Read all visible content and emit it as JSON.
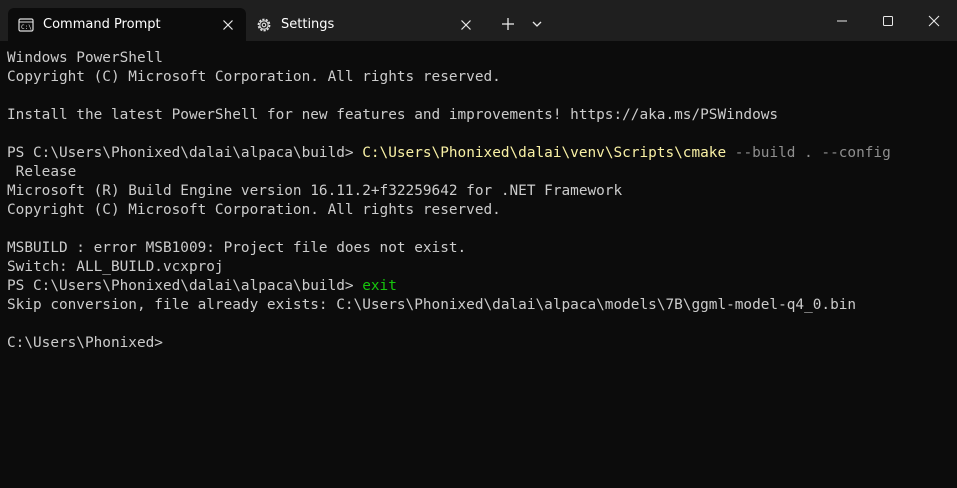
{
  "window": {
    "tabs": [
      {
        "label": "Command Prompt",
        "icon": "terminal-icon",
        "active": true
      },
      {
        "label": "Settings",
        "icon": "gear-icon",
        "active": false
      }
    ],
    "new_tab_icon": "plus-icon",
    "dropdown_icon": "chevron-down-icon",
    "controls": [
      "minimize-icon",
      "maximize-icon",
      "close-icon"
    ]
  },
  "colors": {
    "background": "#0c0c0c",
    "titlebar": "#1f1f1f",
    "text": "#cccccc",
    "command": "#f9f1a5",
    "argument": "#8f8f8f",
    "keyword": "#16c60c"
  },
  "terminal": {
    "lines": [
      [
        {
          "text": "Windows PowerShell"
        }
      ],
      [
        {
          "text": "Copyright (C) Microsoft Corporation. All rights reserved."
        }
      ],
      [],
      [
        {
          "text": "Install the latest PowerShell for new features and improvements! https://aka.ms/PSWindows"
        }
      ],
      [],
      [
        {
          "text": "PS C:\\Users\\Phonixed\\dalai\\alpaca\\build> "
        },
        {
          "text": "C:\\Users\\Phonixed\\dalai\\venv\\Scripts\\cmake",
          "style": "yellow"
        },
        {
          "text": " --build . --config",
          "style": "gray"
        }
      ],
      [
        {
          "text": " Release"
        }
      ],
      [
        {
          "text": "Microsoft (R) Build Engine version 16.11.2+f32259642 for .NET Framework"
        }
      ],
      [
        {
          "text": "Copyright (C) Microsoft Corporation. All rights reserved."
        }
      ],
      [],
      [
        {
          "text": "MSBUILD : error MSB1009: Project file does not exist."
        }
      ],
      [
        {
          "text": "Switch: ALL_BUILD.vcxproj"
        }
      ],
      [
        {
          "text": "PS C:\\Users\\Phonixed\\dalai\\alpaca\\build> "
        },
        {
          "text": "exit",
          "style": "green"
        }
      ],
      [
        {
          "text": "Skip conversion, file already exists: C:\\Users\\Phonixed\\dalai\\alpaca\\models\\7B\\ggml-model-q4_0.bin"
        }
      ],
      [],
      [
        {
          "text": "C:\\Users\\Phonixed>"
        }
      ]
    ]
  }
}
